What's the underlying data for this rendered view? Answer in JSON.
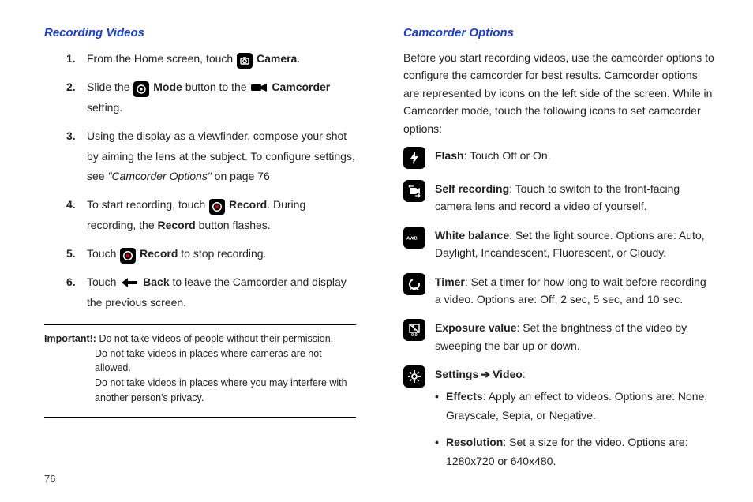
{
  "pageNumber": "76",
  "left": {
    "heading": "Recording Videos",
    "steps": {
      "s1": {
        "pre": "From the Home screen, touch ",
        "label": " Camera",
        "post": "."
      },
      "s2": {
        "pre": "Slide the ",
        "mode": " Mode",
        "mid": " button to the ",
        "cam": " Camcorder",
        "post": " setting."
      },
      "s3": {
        "line1": "Using the display as a viewfinder, compose your shot by aiming the lens at the subject. To configure settings, see ",
        "ref": "\"Camcorder Options\"",
        "line2": " on page 76"
      },
      "s4": {
        "pre": "To start recording, touch ",
        "rec": " Record",
        "mid": ". During recording, the ",
        "rec2": "Record",
        "post": " button flashes."
      },
      "s5": {
        "pre": "Touch ",
        "rec": " Record",
        "post": " to stop recording."
      },
      "s6": {
        "pre": "Touch ",
        "back": " Back",
        "post": " to leave the Camcorder and display the previous screen."
      }
    },
    "important": {
      "label": "Important!:",
      "l1": " Do not take videos of people without their permission.",
      "l2": "Do not take videos in places where cameras are not allowed.",
      "l3": "Do not take videos in places where you may interfere with another person's privacy."
    }
  },
  "right": {
    "heading": "Camcorder Options",
    "intro": "Before you start recording videos, use the camcorder options to configure the camcorder for best results. Camcorder options are represented by icons on the left side of the screen. While in Camcorder mode, touch the following icons to set camcorder options:",
    "flash": {
      "title": "Flash",
      "body": ": Touch Off or On."
    },
    "selfrec": {
      "title": "Self recording",
      "body": ": Touch to switch to the front-facing camera lens and record a video of yourself."
    },
    "wb": {
      "title": "White balance",
      "body": ": Set the light source. Options are: Auto, Daylight, Incandescent, Fluorescent, or Cloudy."
    },
    "timer": {
      "title": "Timer",
      "body": ": Set a timer for how long to wait before recording a video. Options are: Off, 2 sec, 5 sec, and 10 sec."
    },
    "exposure": {
      "title": "Exposure value",
      "body": ": Set the brightness of the video by sweeping the bar up or down."
    },
    "settings": {
      "title": "Settings",
      "arrow": "➔",
      "sub": "Video",
      "colon": ":",
      "effects": {
        "title": "Effects",
        "body": ": Apply an effect to videos. Options are: None, Grayscale, Sepia, or Negative."
      },
      "resolution": {
        "title": "Resolution",
        "body": ": Set a size for the video. Options are: 1280x720 or 640x480."
      }
    }
  }
}
